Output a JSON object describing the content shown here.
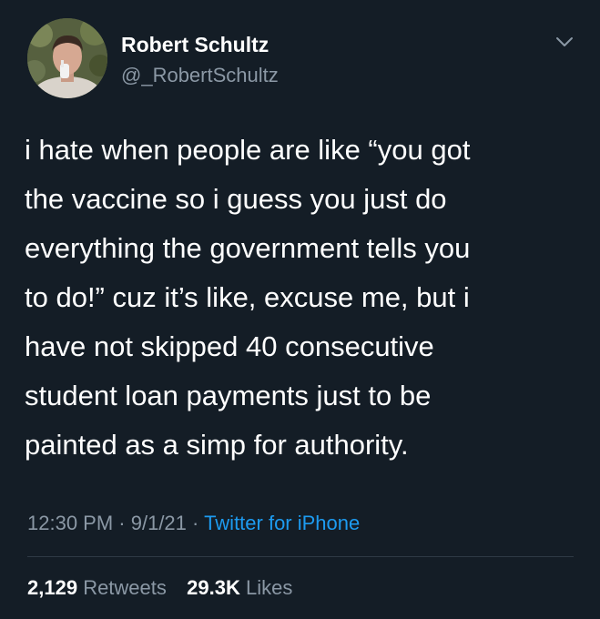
{
  "author": {
    "name": "Robert Schultz",
    "handle": "@_RobertSchultz"
  },
  "icons": {
    "menu": "chevron-down-icon",
    "avatar": "profile-photo"
  },
  "tweet": {
    "lines": [
      "i hate when people are like “you got",
      "the vaccine so i guess you just do",
      "everything the government tells you",
      "to do!” cuz it’s like, excuse me, but i",
      "have not skipped 40 consecutive",
      "student loan payments just to be",
      "painted as a simp for authority."
    ]
  },
  "meta": {
    "time": "12:30 PM",
    "sep1": " · ",
    "date": "9/1/21",
    "sep2": " · ",
    "source": "Twitter for iPhone"
  },
  "stats": {
    "retweets_count": "2,129",
    "retweets_label": "Retweets",
    "likes_count": "29.3K",
    "likes_label": "Likes"
  },
  "colors": {
    "background": "#141d26",
    "secondary_text": "#8b98a5",
    "link": "#1d9bf0",
    "divider": "#2f3a45"
  }
}
